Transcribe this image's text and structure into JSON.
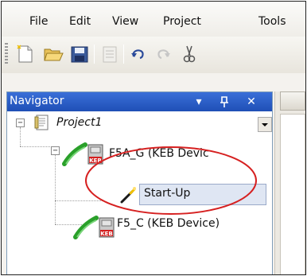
{
  "menu": {
    "file": {
      "label": "File"
    },
    "edit": {
      "label": "Edit"
    },
    "view": {
      "label": "View"
    },
    "project": {
      "label": "Project"
    },
    "tools": {
      "label": "Tools"
    }
  },
  "toolbar": {
    "icons": [
      "new-document-icon",
      "open-folder-icon",
      "save-icon",
      "disabled-icon",
      "undo-icon",
      "redo-icon",
      "cut-icon"
    ]
  },
  "navigator": {
    "title": "Navigator",
    "buttons": {
      "menu": "▾",
      "pin": "ᵠ",
      "close": "✕"
    },
    "tree": {
      "project": "Project1",
      "device1": "F5A_G (KEB Devic",
      "startup": "Start-Up",
      "device2": "F5_C (KEB Device)"
    }
  },
  "annotation": {
    "color": "#d62020"
  },
  "colors": {
    "header": "#2356c4",
    "selection": "#dfe6f3"
  }
}
